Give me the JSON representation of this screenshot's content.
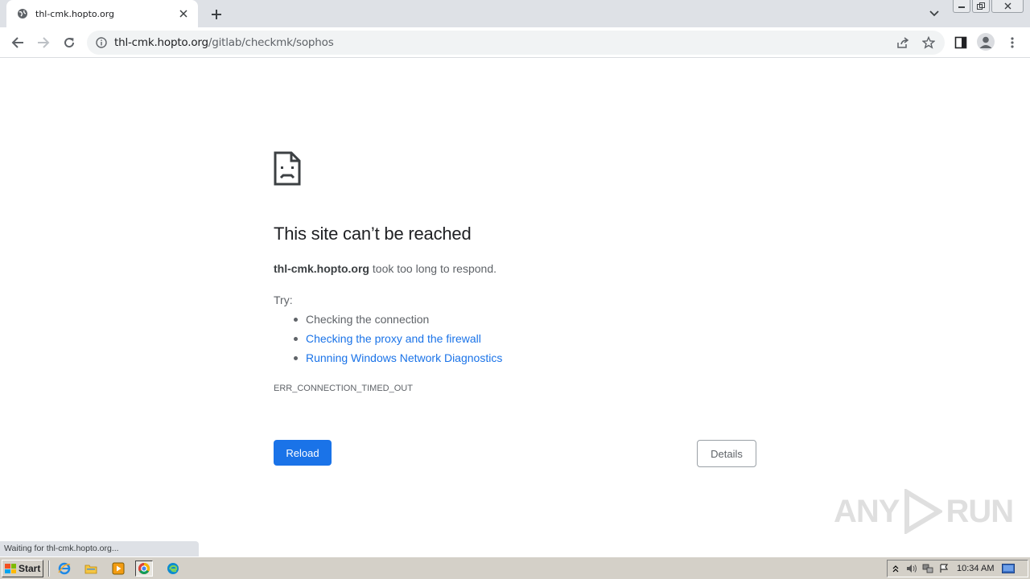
{
  "browser": {
    "tab": {
      "title": "thl-cmk.hopto.org"
    },
    "address": {
      "host": "thl-cmk.hopto.org",
      "path": "/gitlab/checkmk/sophos"
    }
  },
  "error_page": {
    "title": "This site can’t be reached",
    "host_bold": "thl-cmk.hopto.org",
    "message": " took too long to respond.",
    "try_label": "Try:",
    "suggestions": [
      {
        "text": "Checking the connection",
        "link": false
      },
      {
        "text": "Checking the proxy and the firewall",
        "link": true
      },
      {
        "text": "Running Windows Network Diagnostics",
        "link": true
      }
    ],
    "error_code": "ERR_CONNECTION_TIMED_OUT",
    "reload_label": "Reload",
    "details_label": "Details"
  },
  "status_bar": {
    "text": "Waiting for thl-cmk.hopto.org..."
  },
  "watermark": {
    "text_left": "ANY",
    "text_right": "RUN"
  },
  "taskbar": {
    "start_label": "Start",
    "clock": "10:34 AM"
  },
  "colors": {
    "link": "#1a73e8",
    "reload_button": "#1a73e8"
  },
  "icons": [
    "globe-icon",
    "close-icon",
    "plus-icon",
    "back-icon",
    "forward-icon",
    "reload-icon",
    "info-icon",
    "share-icon",
    "star-icon",
    "side-panel-icon",
    "profile-icon",
    "menu-icon",
    "sad-page-icon"
  ]
}
